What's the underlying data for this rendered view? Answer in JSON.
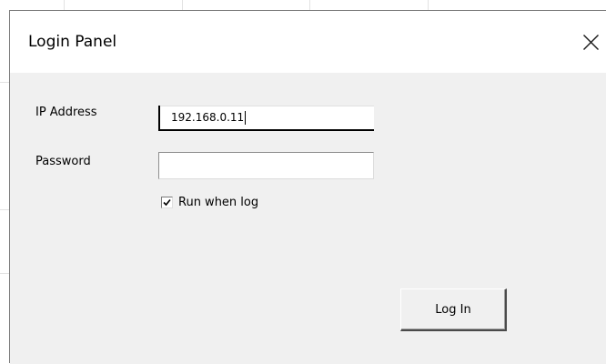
{
  "dialog": {
    "title": "Login Panel",
    "close_icon": "close-icon"
  },
  "form": {
    "ip_label": "IP Address",
    "ip_value": "192.168.0.11",
    "password_label": "Password",
    "password_value": "",
    "run_checkbox_label": "Run when log",
    "run_checkbox_checked": true
  },
  "actions": {
    "login_label": "Log In"
  }
}
